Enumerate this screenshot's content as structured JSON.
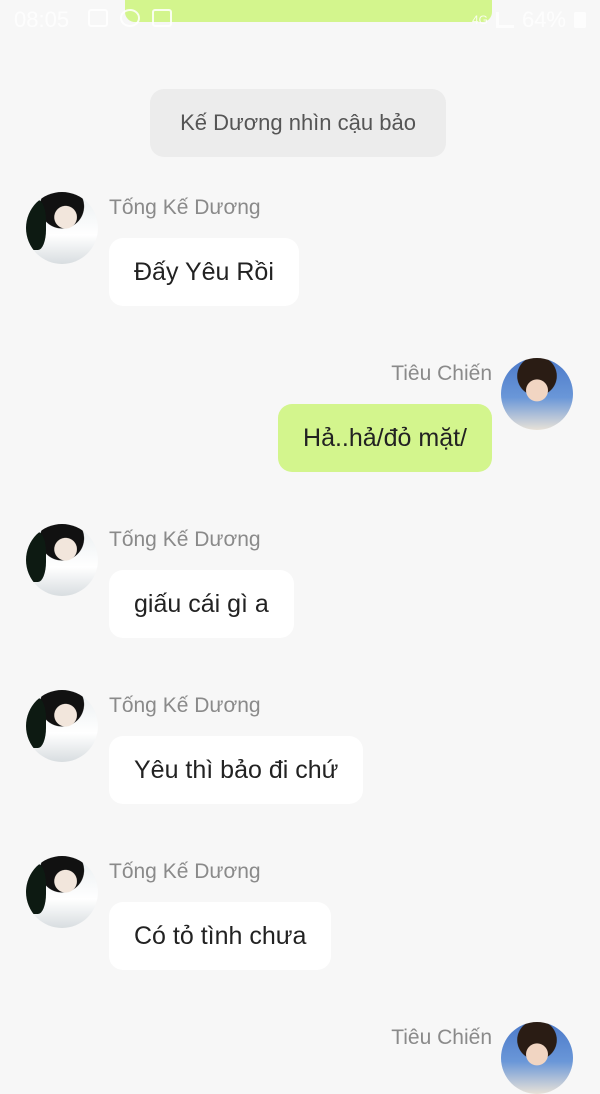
{
  "status_bar": {
    "time": "08:05",
    "network": "4G",
    "battery": "64%"
  },
  "system_message": "Kế Dương nhìn cậu bảo",
  "messages": [
    {
      "sender": "Tống Kế Dương",
      "side": "left",
      "text": "Đấy Yêu Rồi"
    },
    {
      "sender": "Tiêu Chiến",
      "side": "right",
      "text": "Hả..hả/đỏ mặt/"
    },
    {
      "sender": "Tống Kế Dương",
      "side": "left",
      "text": "giấu cái gì a"
    },
    {
      "sender": "Tống Kế Dương",
      "side": "left",
      "text": "Yêu thì bảo đi chứ"
    },
    {
      "sender": "Tống Kế Dương",
      "side": "left",
      "text": "Có tỏ tình chưa"
    },
    {
      "sender": "Tiêu Chiến",
      "side": "right",
      "text": ""
    }
  ],
  "colors": {
    "background": "#f7f7f7",
    "left_bubble": "#ffffff",
    "right_bubble": "#d3f58d",
    "system_bubble": "#ececec",
    "name_text": "#8a8a8a"
  }
}
